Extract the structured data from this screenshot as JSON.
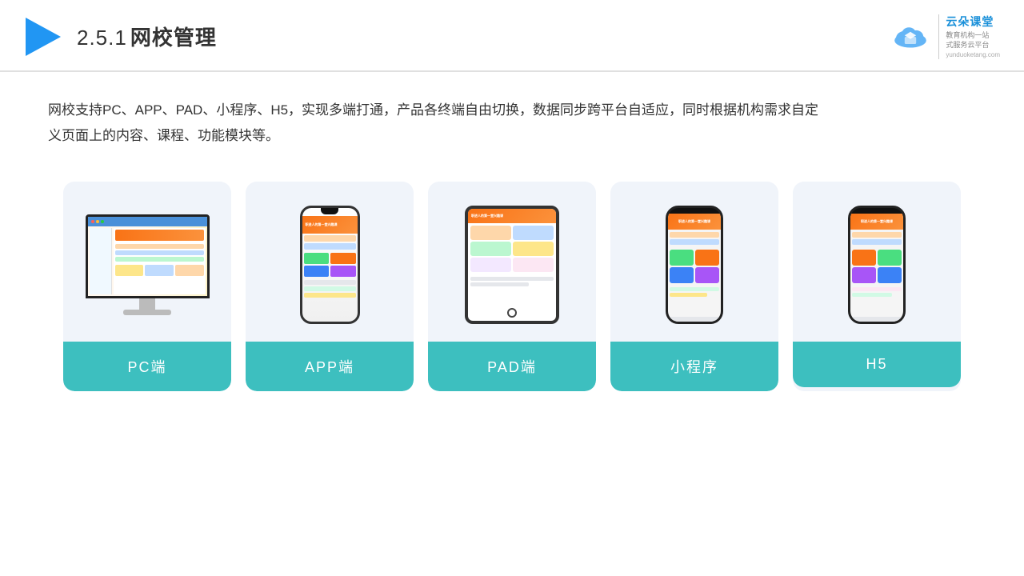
{
  "header": {
    "title_num": "2.5.1",
    "title_text": "网校管理",
    "logo_brand": "云朵课堂",
    "logo_url": "yunduoketang.com",
    "logo_slogan1": "教育机构一站",
    "logo_slogan2": "式服务云平台"
  },
  "description": {
    "text": "网校支持PC、APP、PAD、小程序、H5，实现多端打通，产品各终端自由切换，数据同步跨平台自适应，同时根据机构需求自定义页面上的内容、课程、功能模块等。"
  },
  "cards": [
    {
      "id": "pc",
      "label": "PC端"
    },
    {
      "id": "app",
      "label": "APP端"
    },
    {
      "id": "pad",
      "label": "PAD端"
    },
    {
      "id": "mini",
      "label": "小程序"
    },
    {
      "id": "h5",
      "label": "H5"
    }
  ],
  "colors": {
    "card_bg": "#edf2fb",
    "card_label_bg": "#3dbfbf",
    "header_border": "#e0e0e0",
    "title_color": "#333333"
  }
}
